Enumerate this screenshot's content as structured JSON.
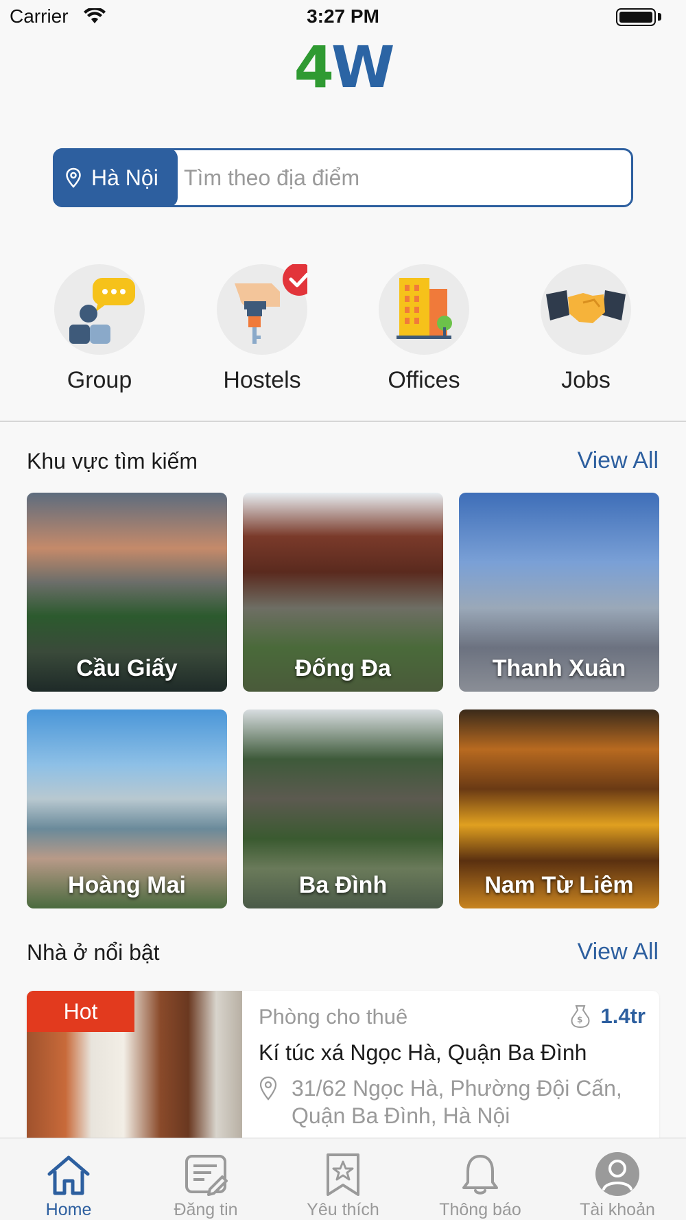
{
  "status_bar": {
    "carrier": "Carrier",
    "time": "3:27 PM"
  },
  "logo": {
    "part1": "4",
    "part2": "W"
  },
  "search": {
    "city": "Hà Nội",
    "placeholder": "Tìm theo địa điểm"
  },
  "categories": [
    {
      "label": "Group",
      "icon": "group-chat-icon"
    },
    {
      "label": "Hostels",
      "icon": "key-check-icon"
    },
    {
      "label": "Offices",
      "icon": "office-building-icon"
    },
    {
      "label": "Jobs",
      "icon": "handshake-icon"
    }
  ],
  "areas_section": {
    "title": "Khu vực tìm kiếm",
    "view_all": "View All",
    "tiles": [
      {
        "label": "Cầu Giấy"
      },
      {
        "label": "Đống Đa"
      },
      {
        "label": "Thanh Xuân"
      },
      {
        "label": "Hoàng Mai"
      },
      {
        "label": "Ba Đình"
      },
      {
        "label": "Nam Từ Liêm"
      }
    ]
  },
  "featured_section": {
    "title": "Nhà ở nổi bật",
    "view_all": "View All",
    "listing": {
      "badge": "Hot",
      "type": "Phòng cho thuê",
      "price": "1.4tr",
      "title": "Kí túc xá Ngọc Hà, Quận Ba Đình",
      "address_line1": "31/62 Ngọc Hà, Phường Đội Cấn,",
      "address_line2": "Quận Ba Đình, Hà Nội"
    }
  },
  "tabbar": [
    {
      "label": "Home",
      "active": true
    },
    {
      "label": "Đăng tin",
      "active": false
    },
    {
      "label": "Yêu thích",
      "active": false
    },
    {
      "label": "Thông báo",
      "active": false
    },
    {
      "label": "Tài khoản",
      "active": false
    }
  ],
  "colors": {
    "brand_blue": "#2d5f9f",
    "brand_green": "#2f9a32",
    "hot_red": "#e23a1e"
  }
}
